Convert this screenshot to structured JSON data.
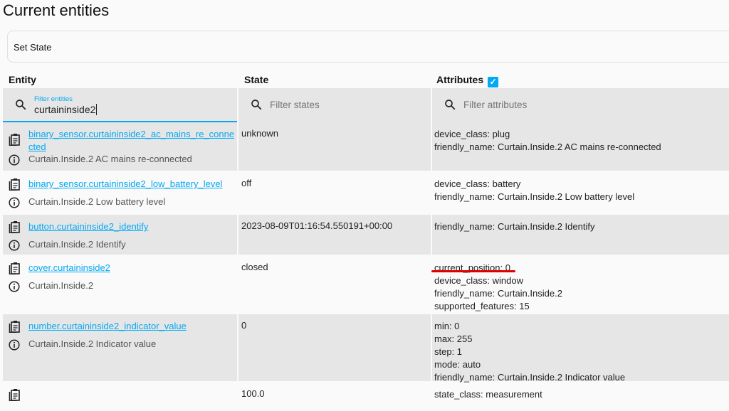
{
  "title": "Current entities",
  "set_state_label": "Set State",
  "headers": {
    "entity": "Entity",
    "state": "State",
    "attributes": "Attributes"
  },
  "attributes_checkbox_checked": true,
  "filters": {
    "entity_label": "Filter entities",
    "entity_value": "curtaininside2",
    "state_placeholder": "Filter states",
    "attributes_placeholder": "Filter attributes"
  },
  "rows": [
    {
      "entity": "binary_sensor.curtaininside2_ac_mains_re_connected",
      "name": "Curtain.Inside.2 AC mains re-connected",
      "state": "unknown",
      "attributes": [
        "device_class: plug",
        "friendly_name: Curtain.Inside.2 AC mains re-connected"
      ]
    },
    {
      "entity": "binary_sensor.curtaininside2_low_battery_level",
      "name": "Curtain.Inside.2 Low battery level",
      "state": "off",
      "attributes": [
        "device_class: battery",
        "friendly_name: Curtain.Inside.2 Low battery level"
      ]
    },
    {
      "entity": "button.curtaininside2_identify",
      "name": "Curtain.Inside.2 Identify",
      "state": "2023-08-09T01:16:54.550191+00:00",
      "attributes": [
        "friendly_name: Curtain.Inside.2 Identify"
      ]
    },
    {
      "entity": "cover.curtaininside2",
      "name": "Curtain.Inside.2",
      "state": "closed",
      "attributes": [
        "current_position: 0",
        "device_class: window",
        "friendly_name: Curtain.Inside.2",
        "supported_features: 15"
      ]
    },
    {
      "entity": "number.curtaininside2_indicator_value",
      "name": "Curtain.Inside.2 Indicator value",
      "state": "0",
      "attributes": [
        "min: 0",
        "max: 255",
        "step: 1",
        "mode: auto",
        "friendly_name: Curtain.Inside.2 Indicator value"
      ]
    },
    {
      "entity": "",
      "name": "",
      "state": "100.0",
      "attributes": [
        "state_class: measurement"
      ]
    }
  ]
}
